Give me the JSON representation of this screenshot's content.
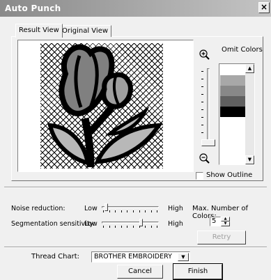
{
  "window": {
    "title": "Auto Punch",
    "close_glyph": "×"
  },
  "tabs": [
    {
      "label": "Result View",
      "active": true
    },
    {
      "label": "Original View",
      "active": false
    }
  ],
  "preview": {
    "icon": "tulip-punch-preview"
  },
  "zoom": {
    "in_icon": "zoom-in-icon",
    "out_icon": "zoom-out-icon"
  },
  "omit_colors": {
    "label": "Omit Colors",
    "swatches": [
      "#ffffff",
      "#a8a8a8",
      "#888888",
      "#606060",
      "#000000"
    ]
  },
  "show_outline": {
    "label": "Show Outline",
    "checked": false
  },
  "noise_reduction": {
    "label": "Noise reduction:",
    "low": "Low",
    "high": "High",
    "level_fraction": 0.05
  },
  "segmentation": {
    "label": "Segmentation sensitivity:",
    "low": "Low",
    "high": "High",
    "level_fraction": 0.7
  },
  "max_colors": {
    "label": "Max. Number of Colors:",
    "value": "5"
  },
  "retry": {
    "label": "Retry"
  },
  "thread_chart": {
    "label": "Thread Chart:",
    "value": "BROTHER EMBROIDERY"
  },
  "buttons": {
    "cancel": "Cancel",
    "finish": "Finish"
  },
  "colors": {
    "titlebar_start": "#8a8a8a",
    "titlebar_end": "#c4c4c4",
    "face": "#f0f0f0"
  }
}
